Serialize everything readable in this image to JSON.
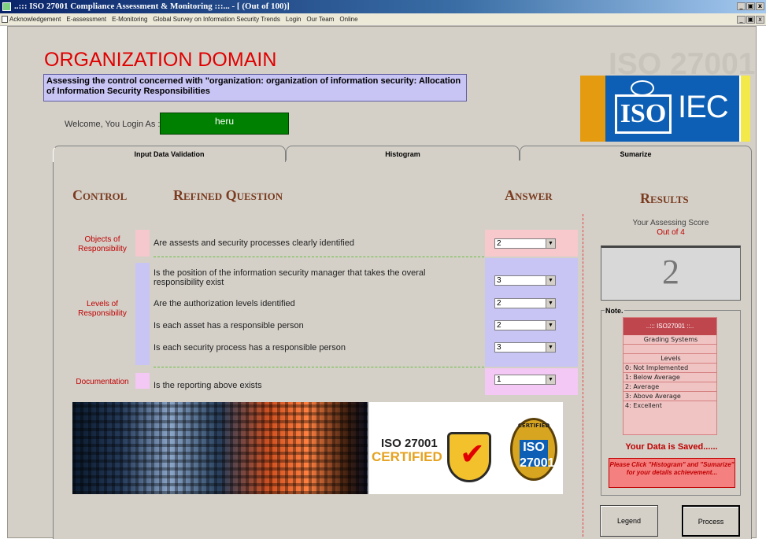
{
  "window": {
    "title": "..::: ISO 27001 Compliance Assessment & Monitoring :::... - [ (Out of 100)]"
  },
  "menu": [
    "Acknowledgement",
    "E-assessment",
    "E-Monitoring",
    "Global Survey on Information Security Trends",
    "Login",
    "Our Team",
    "Online"
  ],
  "header": {
    "title": "ORGANIZATION DOMAIN",
    "assessing": "Assessing the control concerned with \"organization: organization of information security: Allocation of Information Security Responsibilities",
    "welcome": "Welcome, You Login As :",
    "user": "heru",
    "watermark": "ISO 27001",
    "logo_iso": "ISO",
    "logo_iec": "IEC"
  },
  "tabs": [
    "Input Data Validation",
    "Histogram",
    "Sumarize"
  ],
  "columns": {
    "control": "Control",
    "question": "Refined Question",
    "answer": "Answer",
    "results": "Results"
  },
  "controls": [
    {
      "label": "Objects of Responsibility",
      "questions": [
        {
          "text": "Are assests and security processes clearly identified",
          "answer": "2"
        }
      ]
    },
    {
      "label": "Levels of Responsibility",
      "questions": [
        {
          "text": "Is the position of the information security manager that takes the overal responsibility exist",
          "answer": "3"
        },
        {
          "text": "Are the authorization levels identified",
          "answer": "2"
        },
        {
          "text": "Is each asset has a responsible person",
          "answer": "2"
        },
        {
          "text": "Is each security process has a responsible person",
          "answer": "3"
        }
      ]
    },
    {
      "label": "Documentation",
      "questions": [
        {
          "text": "Is the reporting above exists",
          "answer": "1"
        }
      ]
    }
  ],
  "results": {
    "score_label": "Your Assessing Score",
    "out_of": "Out of 4",
    "score": "2",
    "note": "Note.",
    "grading_title": "..::: ISO27001 ::..",
    "grading_sub": "Grading Systems",
    "levels_title": "Levels",
    "levels": [
      "0: Not Implemented",
      "1: Below Average",
      "2: Average",
      "3: Above Average",
      "4: Excellent"
    ],
    "saved": "Your Data is Saved......",
    "hint": "Please Click \"Histogram\" and \"Sumarize\" for your details achievement...",
    "legend_btn": "Legend",
    "process_btn": "Process"
  },
  "banner": {
    "cert_line1": "ISO 27001",
    "cert_line2": "CERTIFIED",
    "seal_top": "CERTIFIED",
    "seal_text": "ISO 27001"
  },
  "colors": {
    "title_red": "#e00000",
    "header_brown": "#7a3b1f",
    "user_green": "#008000",
    "assess_bg": "#c8c4f4"
  }
}
